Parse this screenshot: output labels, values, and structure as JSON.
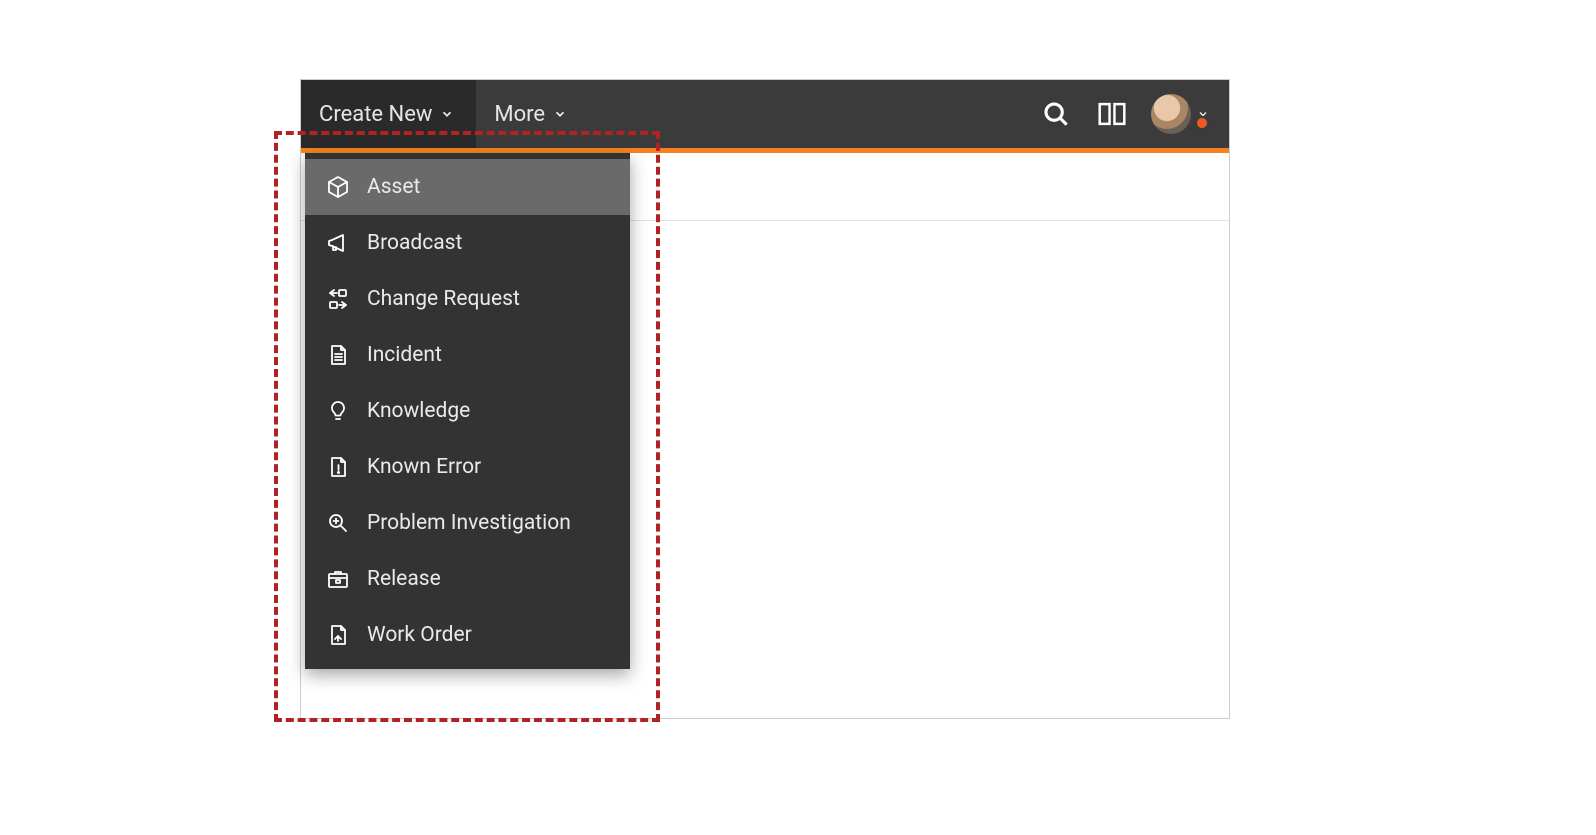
{
  "topbar": {
    "create_new_label": "Create New",
    "more_label": "More"
  },
  "dropdown": {
    "items": [
      {
        "label": "Asset",
        "icon": "cube",
        "hover": true
      },
      {
        "label": "Broadcast",
        "icon": "megaphone",
        "hover": false
      },
      {
        "label": "Change Request",
        "icon": "swap",
        "hover": false
      },
      {
        "label": "Incident",
        "icon": "doc-lines",
        "hover": false
      },
      {
        "label": "Knowledge",
        "icon": "bulb",
        "hover": false
      },
      {
        "label": "Known Error",
        "icon": "doc-alert",
        "hover": false
      },
      {
        "label": "Problem Investigation",
        "icon": "search-doc",
        "hover": false
      },
      {
        "label": "Release",
        "icon": "package",
        "hover": false
      },
      {
        "label": "Work Order",
        "icon": "doc-arrow",
        "hover": false
      }
    ]
  }
}
